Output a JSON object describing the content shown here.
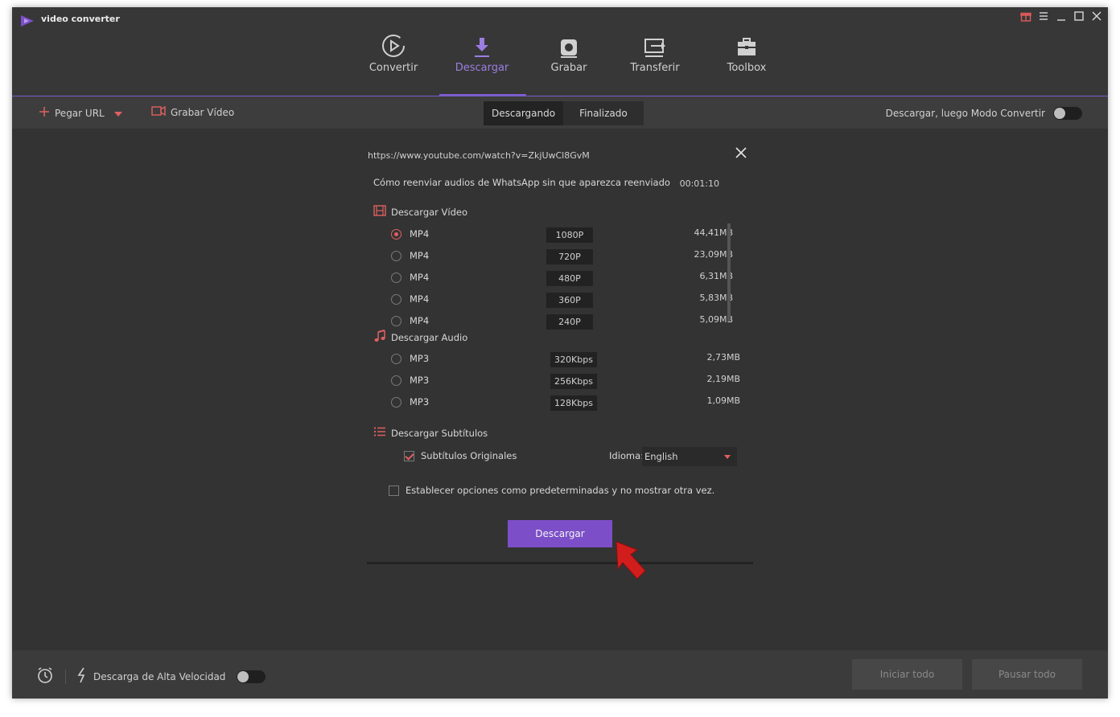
{
  "app": {
    "title": "video converter"
  },
  "nav": {
    "items": [
      {
        "label": "Convertir",
        "icon": "play-circle-icon",
        "active": false
      },
      {
        "label": "Descargar",
        "icon": "download-icon",
        "active": true
      },
      {
        "label": "Grabar",
        "icon": "record-icon",
        "active": false
      },
      {
        "label": "Transferir",
        "icon": "transfer-icon",
        "active": false
      },
      {
        "label": "Toolbox",
        "icon": "toolbox-icon",
        "active": false
      }
    ]
  },
  "toolbar": {
    "paste_url": "Pegar URL",
    "record_video": "Grabar Vídeo",
    "tabs": [
      "Descargando",
      "Finalizado"
    ],
    "mode_label": "Descargar, luego Modo Convertir",
    "mode_enabled": false
  },
  "dialog": {
    "url": "https://www.youtube.com/watch?v=ZkjUwCl8GvM",
    "video_title": "Cómo reenviar audios de WhatsApp sin que aparezca reenviado",
    "duration": "00:01:10",
    "video_section": "Descargar Vídeo",
    "video_options": [
      {
        "format": "MP4",
        "quality": "1080P",
        "size": "44,41MB",
        "selected": true
      },
      {
        "format": "MP4",
        "quality": "720P",
        "size": "23,09MB",
        "selected": false
      },
      {
        "format": "MP4",
        "quality": "480P",
        "size": "6,31MB",
        "selected": false
      },
      {
        "format": "MP4",
        "quality": "360P",
        "size": "5,83MB",
        "selected": false
      },
      {
        "format": "MP4",
        "quality": "240P",
        "size": "5,09MB",
        "selected": false
      }
    ],
    "audio_section": "Descargar Audio",
    "audio_options": [
      {
        "format": "MP3",
        "quality": "320Kbps",
        "size": "2,73MB",
        "selected": false
      },
      {
        "format": "MP3",
        "quality": "256Kbps",
        "size": "2,19MB",
        "selected": false
      },
      {
        "format": "MP3",
        "quality": "128Kbps",
        "size": "1,09MB",
        "selected": false
      }
    ],
    "subtitle_section": "Descargar Subtítulos",
    "subtitle_original_label": "Subtítulos Originales",
    "subtitle_original_checked": true,
    "language_label": "Idioma:",
    "language_value": "English",
    "default_option_label": "Establecer opciones como predeterminadas y no mostrar otra vez.",
    "default_option_checked": false,
    "download_button": "Descargar"
  },
  "statusbar": {
    "high_speed_label": "Descarga de Alta Velocidad",
    "high_speed_enabled": false,
    "start_all": "Iniciar todo",
    "pause_all": "Pausar todo"
  },
  "colors": {
    "accent": "#7c4fc8",
    "highlight_red": "#e06060",
    "background": "#333333"
  }
}
